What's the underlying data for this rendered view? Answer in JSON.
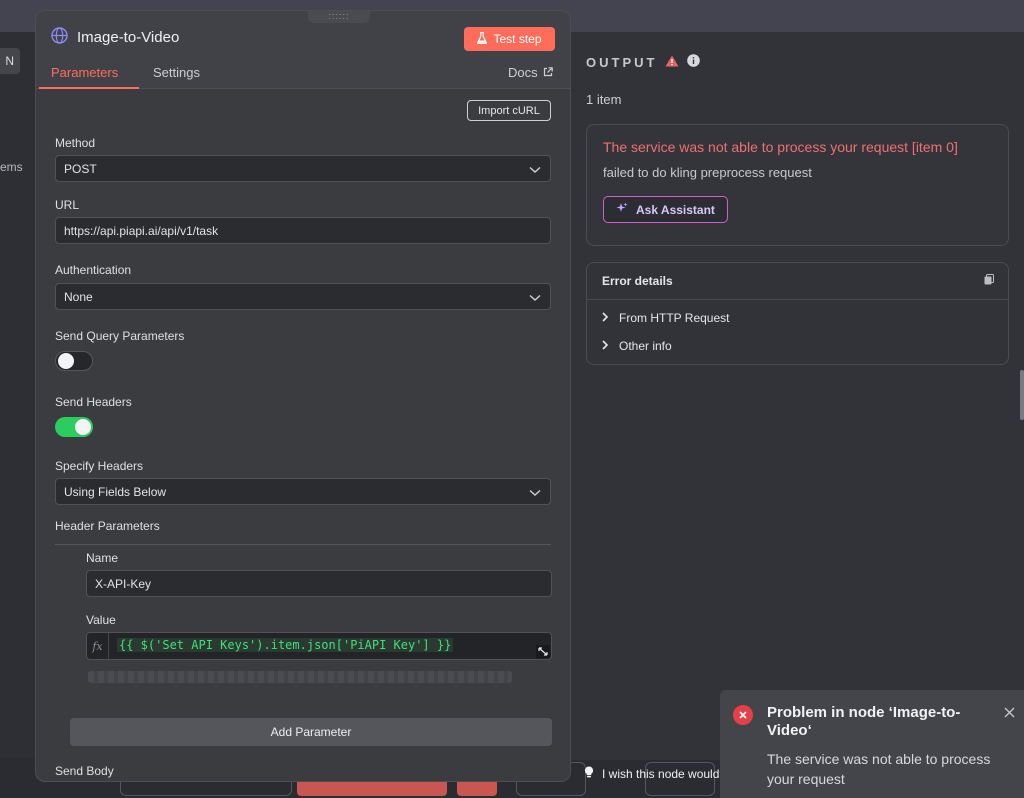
{
  "canvas": {
    "left_button_fragment": "N",
    "left_items_fragment": "ems",
    "hint_text": "I wish this node would"
  },
  "node": {
    "title": "Image-to-Video",
    "test_step_label": "Test step",
    "tabs": [
      {
        "label": "Parameters",
        "active": true
      },
      {
        "label": "Settings",
        "active": false
      }
    ],
    "docs_label": "Docs"
  },
  "params": {
    "import_curl_label": "Import cURL",
    "method": {
      "label": "Method",
      "value": "POST"
    },
    "url": {
      "label": "URL",
      "value": "https://api.piapi.ai/api/v1/task"
    },
    "authentication": {
      "label": "Authentication",
      "value": "None"
    },
    "send_query": {
      "label": "Send Query Parameters",
      "enabled": false
    },
    "send_headers": {
      "label": "Send Headers",
      "enabled": true
    },
    "specify_headers": {
      "label": "Specify Headers",
      "value": "Using Fields Below"
    },
    "header_parameters": {
      "label": "Header Parameters",
      "name_label": "Name",
      "name_value": "X-API-Key",
      "value_label": "Value",
      "value_expression": "{{ $('Set API Keys').item.json['PiAPI Key'] }}"
    },
    "add_parameter_label": "Add Parameter",
    "send_body_label": "Send Body"
  },
  "output": {
    "title": "OUTPUT",
    "item_count": "1 item",
    "error": {
      "title": "The service was not able to process your request [item 0]",
      "subtitle": "failed to do kling preprocess request",
      "ask_label": "Ask Assistant"
    },
    "details": {
      "title": "Error details",
      "rows": [
        "From HTTP Request",
        "Other info"
      ]
    }
  },
  "toast": {
    "title": "Problem in node ‘Image-to-Video‘",
    "body": "The service was not able to process your request"
  },
  "colors": {
    "accent": "#ff6d5a",
    "toggle_on": "#2bcd5e",
    "error_text": "#f07070",
    "expression_green": "#3fe07a"
  }
}
